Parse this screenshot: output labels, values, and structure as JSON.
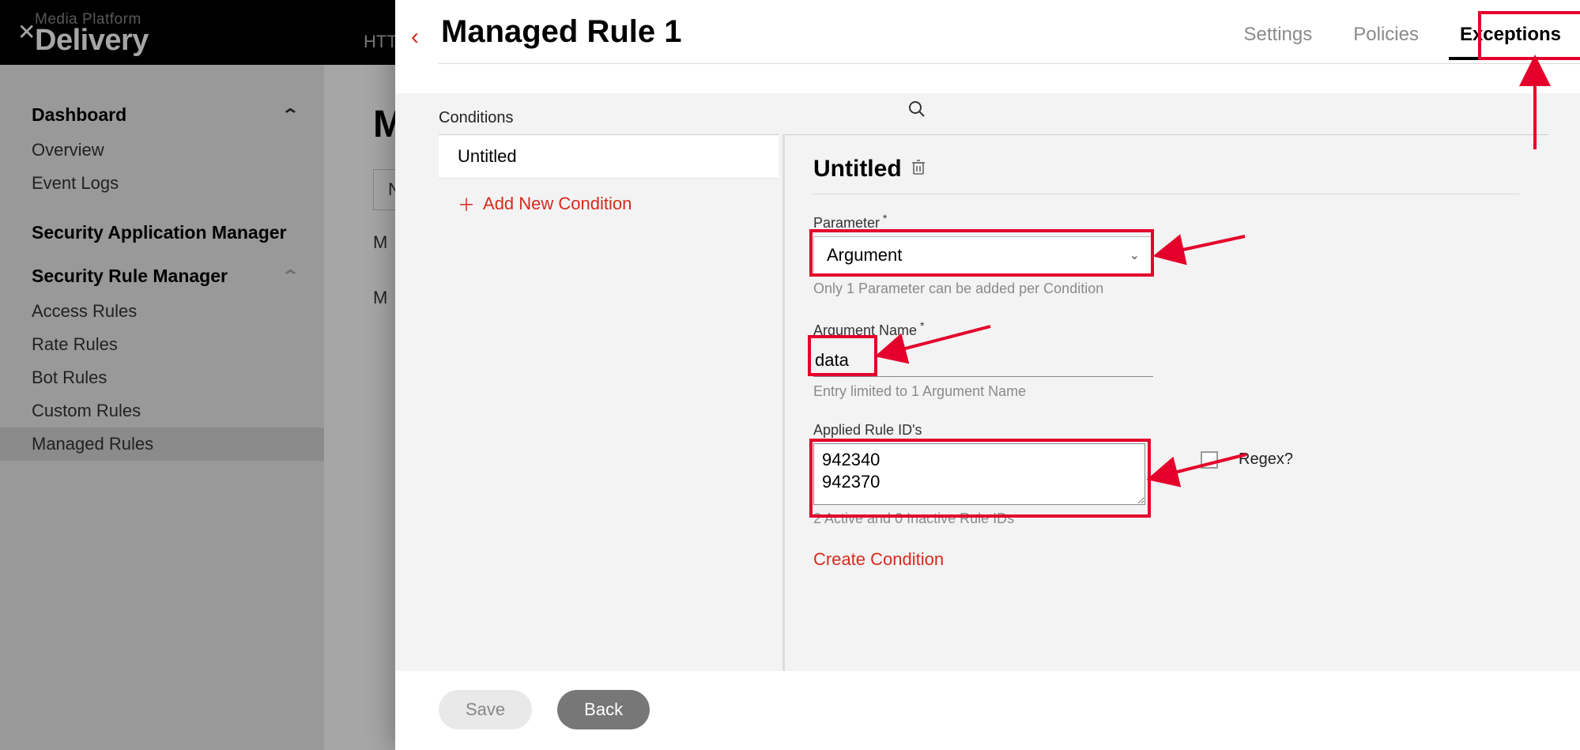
{
  "brand": {
    "small": "Media Platform",
    "big": "Delivery",
    "secondary": "HTT"
  },
  "sidebar": {
    "sections": [
      {
        "title": "Dashboard",
        "collapsible": true,
        "items": [
          "Overview",
          "Event Logs"
        ]
      },
      {
        "title": "Security Application Manager",
        "collapsible": false,
        "items": []
      },
      {
        "title": "Security Rule Manager",
        "collapsible": true,
        "items": [
          "Access Rules",
          "Rate Rules",
          "Bot Rules",
          "Custom Rules",
          "Managed Rules"
        ]
      }
    ],
    "active_item": "Managed Rules"
  },
  "bg_main": {
    "title_initial": "M",
    "tabs": [
      "N",
      "M",
      "M"
    ]
  },
  "drawer": {
    "title": "Managed Rule 1",
    "tabs": {
      "settings": "Settings",
      "policies": "Policies",
      "exceptions": "Exceptions",
      "active": "exceptions"
    },
    "conditions_label": "Conditions",
    "condition_items": [
      "Untitled"
    ],
    "add_condition": "Add New Condition",
    "detail": {
      "title": "Untitled",
      "parameter": {
        "label": "Parameter",
        "value": "Argument",
        "helper": "Only 1 Parameter can be added per Condition"
      },
      "argument_name": {
        "label": "Argument Name",
        "value": "data",
        "helper": "Entry limited to 1 Argument Name",
        "regex_label": "Regex?",
        "regex_checked": false
      },
      "applied_rule_ids": {
        "label": "Applied Rule ID's",
        "value": "942340\n942370",
        "helper": "2 Active and 0 Inactive Rule IDs"
      },
      "create_condition": "Create Condition"
    },
    "footer": {
      "save": "Save",
      "back": "Back"
    }
  }
}
